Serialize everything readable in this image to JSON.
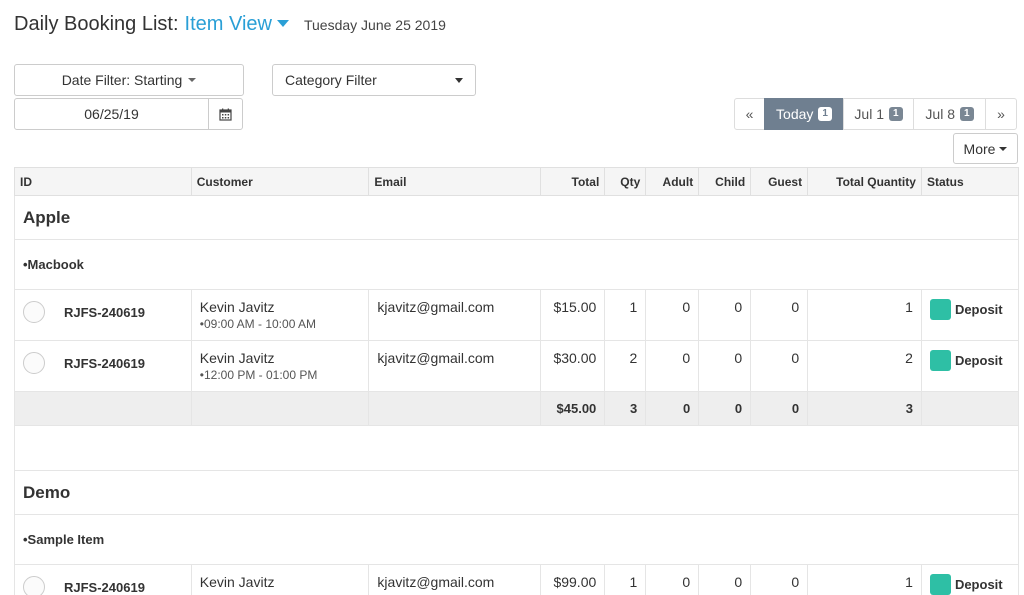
{
  "header": {
    "title": "Daily Booking List:",
    "view_label": "Item View",
    "date_text": "Tuesday June 25 2019"
  },
  "filters": {
    "date_filter_label": "Date Filter: Starting",
    "category_filter_label": "Category Filter",
    "date_value": "06/25/19"
  },
  "pager": {
    "prev": "«",
    "next": "»",
    "pages": [
      {
        "label": "Today",
        "count": "1",
        "active": true
      },
      {
        "label": "Jul 1",
        "count": "1",
        "active": false
      },
      {
        "label": "Jul 8",
        "count": "1",
        "active": false
      }
    ]
  },
  "more_label": "More",
  "table": {
    "headers": [
      "ID",
      "Customer",
      "Email",
      "Total",
      "Qty",
      "Adult",
      "Child",
      "Guest",
      "Total Quantity",
      "Status"
    ],
    "groups": [
      {
        "name": "Apple",
        "items": [
          {
            "name": "•Macbook",
            "rows": [
              {
                "id": "RJFS-240619",
                "customer": "Kevin Javitz",
                "time": "•09:00 AM - 10:00 AM",
                "email": "kjavitz@gmail.com",
                "total": "$15.00",
                "qty": "1",
                "adult": "0",
                "child": "0",
                "guest": "0",
                "total_qty": "1",
                "status": "Deposit"
              },
              {
                "id": "RJFS-240619",
                "customer": "Kevin Javitz",
                "time": "•12:00 PM - 01:00 PM",
                "email": "kjavitz@gmail.com",
                "total": "$30.00",
                "qty": "2",
                "adult": "0",
                "child": "0",
                "guest": "0",
                "total_qty": "2",
                "status": "Deposit"
              }
            ],
            "summary": {
              "total": "$45.00",
              "qty": "3",
              "adult": "0",
              "child": "0",
              "guest": "0",
              "total_qty": "3"
            }
          }
        ]
      },
      {
        "name": "Demo",
        "items": [
          {
            "name": "•Sample Item",
            "rows": [
              {
                "id": "RJFS-240619",
                "customer": "Kevin Javitz",
                "time": "",
                "email": "kjavitz@gmail.com",
                "total": "$99.00",
                "qty": "1",
                "adult": "0",
                "child": "0",
                "guest": "0",
                "total_qty": "1",
                "status": "Deposit"
              }
            ]
          }
        ]
      }
    ]
  },
  "colors": {
    "accent": "#2a9fd6",
    "deposit": "#2ebfa5",
    "active_page": "#6f7f90"
  }
}
